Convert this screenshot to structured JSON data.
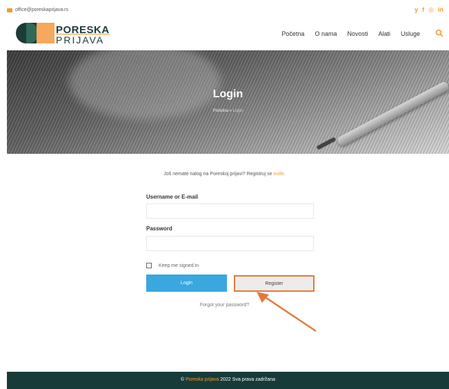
{
  "topbar": {
    "email": "office@poreskaprijava.rs",
    "social_icons": [
      "twitter-icon",
      "facebook-icon",
      "instagram-icon",
      "linkedin-icon"
    ],
    "social_glyphs": [
      "y",
      "f",
      "◎",
      "in"
    ]
  },
  "logo": {
    "line1": "PORESKA",
    "line2": "PRIJAVA"
  },
  "nav": {
    "items": [
      "Početna",
      "O nama",
      "Novosti",
      "Alati",
      "Usluge"
    ]
  },
  "hero": {
    "title": "Login",
    "breadcrumb_home": "Početna",
    "breadcrumb_sep": " » ",
    "breadcrumb_current": "Login"
  },
  "register_note": {
    "text": "Još nemate nalog na Poreskoj prijavi? Registruj se ",
    "link": "ovde",
    "end": "."
  },
  "form": {
    "username_label": "Username or E-mail",
    "username_value": "",
    "password_label": "Password",
    "password_value": "",
    "keep_signed_in": "Keep me signed in",
    "login_button": "Login",
    "register_button": "Register",
    "forgot": "Forgot your password?"
  },
  "footer": {
    "prefix": "© ",
    "brand": "Poreska prijava",
    "rest": " 2022   Sva prava zadržana"
  },
  "colors": {
    "accent": "#f29a33",
    "login_button": "#3aa7df",
    "footer": "#173b39",
    "highlight": "#e27a3c"
  }
}
